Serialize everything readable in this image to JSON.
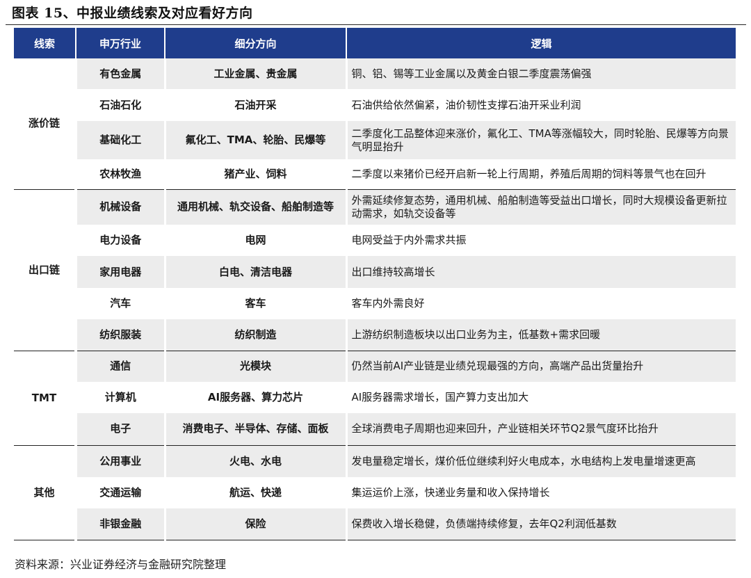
{
  "title": "图表 15、中报业绩线索及对应看好方向",
  "headers": {
    "chain": "线索",
    "industry": "申万行业",
    "sub": "细分方向",
    "logic": "逻辑"
  },
  "groups": [
    {
      "chain": "涨价链",
      "rows": [
        {
          "industry": "有色金属",
          "sub": "工业金属、贵金属",
          "logic": "铜、铝、锡等工业金属以及黄金白银二季度震荡偏强"
        },
        {
          "industry": "石油石化",
          "sub": "石油开采",
          "logic": "石油供给依然偏紧，油价韧性支撑石油开采业利润"
        },
        {
          "industry": "基础化工",
          "sub": "氟化工、TMA、轮胎、民爆等",
          "logic": "二季度化工品整体迎来涨价，氟化工、TMA等涨幅较大，同时轮胎、民爆等方向景气明显抬升"
        },
        {
          "industry": "农林牧渔",
          "sub": "猪产业、饲料",
          "logic": "二季度以来猪价已经开启新一轮上行周期，养殖后周期的饲料等景气也在回升"
        }
      ]
    },
    {
      "chain": "出口链",
      "rows": [
        {
          "industry": "机械设备",
          "sub": "通用机械、轨交设备、船舶制造等",
          "logic": "外需延续修复态势，通用机械、船舶制造等受益出口增长，同时大规模设备更新拉动需求，如轨交设备等"
        },
        {
          "industry": "电力设备",
          "sub": "电网",
          "logic": "电网受益于内外需求共振"
        },
        {
          "industry": "家用电器",
          "sub": "白电、清洁电器",
          "logic": "出口维持较高增长"
        },
        {
          "industry": "汽车",
          "sub": "客车",
          "logic": "客车内外需良好"
        },
        {
          "industry": "纺织服装",
          "sub": "纺织制造",
          "logic": "上游纺织制造板块以出口业务为主，低基数+需求回暖"
        }
      ]
    },
    {
      "chain": "TMT",
      "rows": [
        {
          "industry": "通信",
          "sub": "光模块",
          "logic": "仍然当前AI产业链是业绩兑现最强的方向，高端产品出货量抬升"
        },
        {
          "industry": "计算机",
          "sub": "AI服务器、算力芯片",
          "logic": "AI服务器需求增长，国产算力支出加大"
        },
        {
          "industry": "电子",
          "sub": "消费电子、半导体、存储、面板",
          "logic": "全球消费电子周期也迎来回升，产业链相关环节Q2景气度环比抬升"
        }
      ]
    },
    {
      "chain": "其他",
      "rows": [
        {
          "industry": "公用事业",
          "sub": "火电、水电",
          "logic": "发电量稳定增长，煤价低位继续利好火电成本，水电结构上发电量增速更高"
        },
        {
          "industry": "交通运输",
          "sub": "航运、快递",
          "logic": "集运运价上涨，快递业务量和收入保持增长"
        },
        {
          "industry": "非银金融",
          "sub": "保险",
          "logic": "保费收入增长稳健，负债端持续修复，去年Q2利润低基数"
        }
      ]
    }
  ],
  "source": "资料来源：兴业证券经济与金融研究院整理",
  "colors": {
    "header_bg": "#1f3d8c",
    "row_shade": "#ececec"
  }
}
